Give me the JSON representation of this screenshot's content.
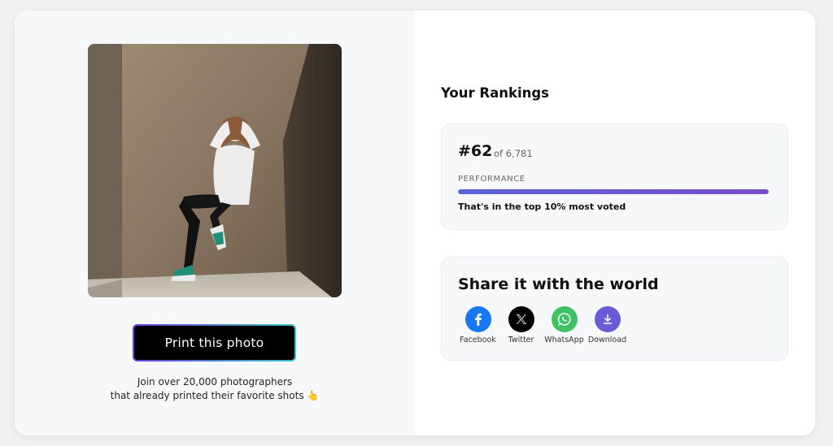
{
  "left": {
    "print_button": "Print this photo",
    "join_line1": "Join over 20,000 photographers",
    "join_line2": "that already printed their favorite shots 👆"
  },
  "rankings": {
    "title": "Your Rankings",
    "rank": "#62",
    "of_total": "of 6,781",
    "performance_label": "PERFORMANCE",
    "performance_fraction": 1.0,
    "summary": "That's in the top 10% most voted"
  },
  "share": {
    "title": "Share it with the world",
    "items": [
      {
        "label": "Facebook",
        "icon": "facebook-icon",
        "color": "#1877f2"
      },
      {
        "label": "Twitter",
        "icon": "x-icon",
        "color": "#000000"
      },
      {
        "label": "WhatsApp",
        "icon": "whatsapp-icon",
        "color": "#3dc266"
      },
      {
        "label": "Download",
        "icon": "download-icon",
        "color": "#6b5bd6"
      }
    ]
  }
}
